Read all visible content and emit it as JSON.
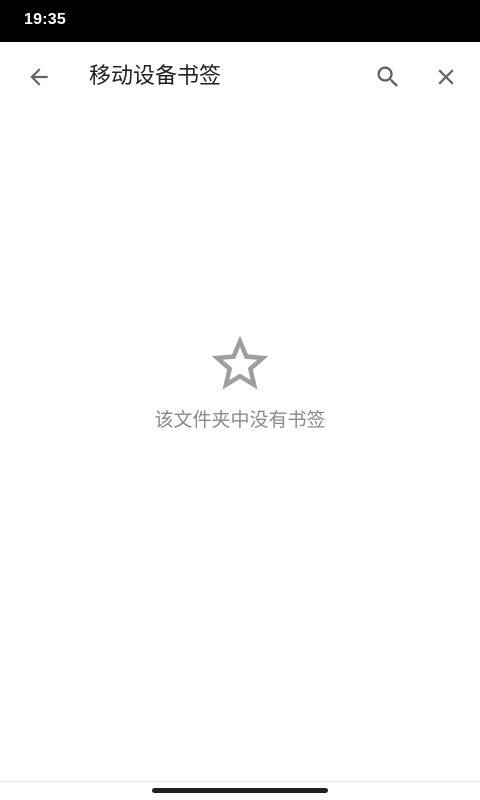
{
  "status_bar": {
    "time": "19:35"
  },
  "app_bar": {
    "title": "移动设备书签",
    "back_icon": "arrow-back-icon",
    "search_icon": "search-icon",
    "close_icon": "close-icon"
  },
  "empty_state": {
    "icon": "star-outline-icon",
    "message": "该文件夹中没有书签"
  },
  "colors": {
    "status_bar_bg": "#000000",
    "background": "#ffffff",
    "icon": "#5f6368",
    "title_text": "#202124",
    "empty_icon": "#9e9e9e",
    "empty_text": "#8a8a8a"
  }
}
